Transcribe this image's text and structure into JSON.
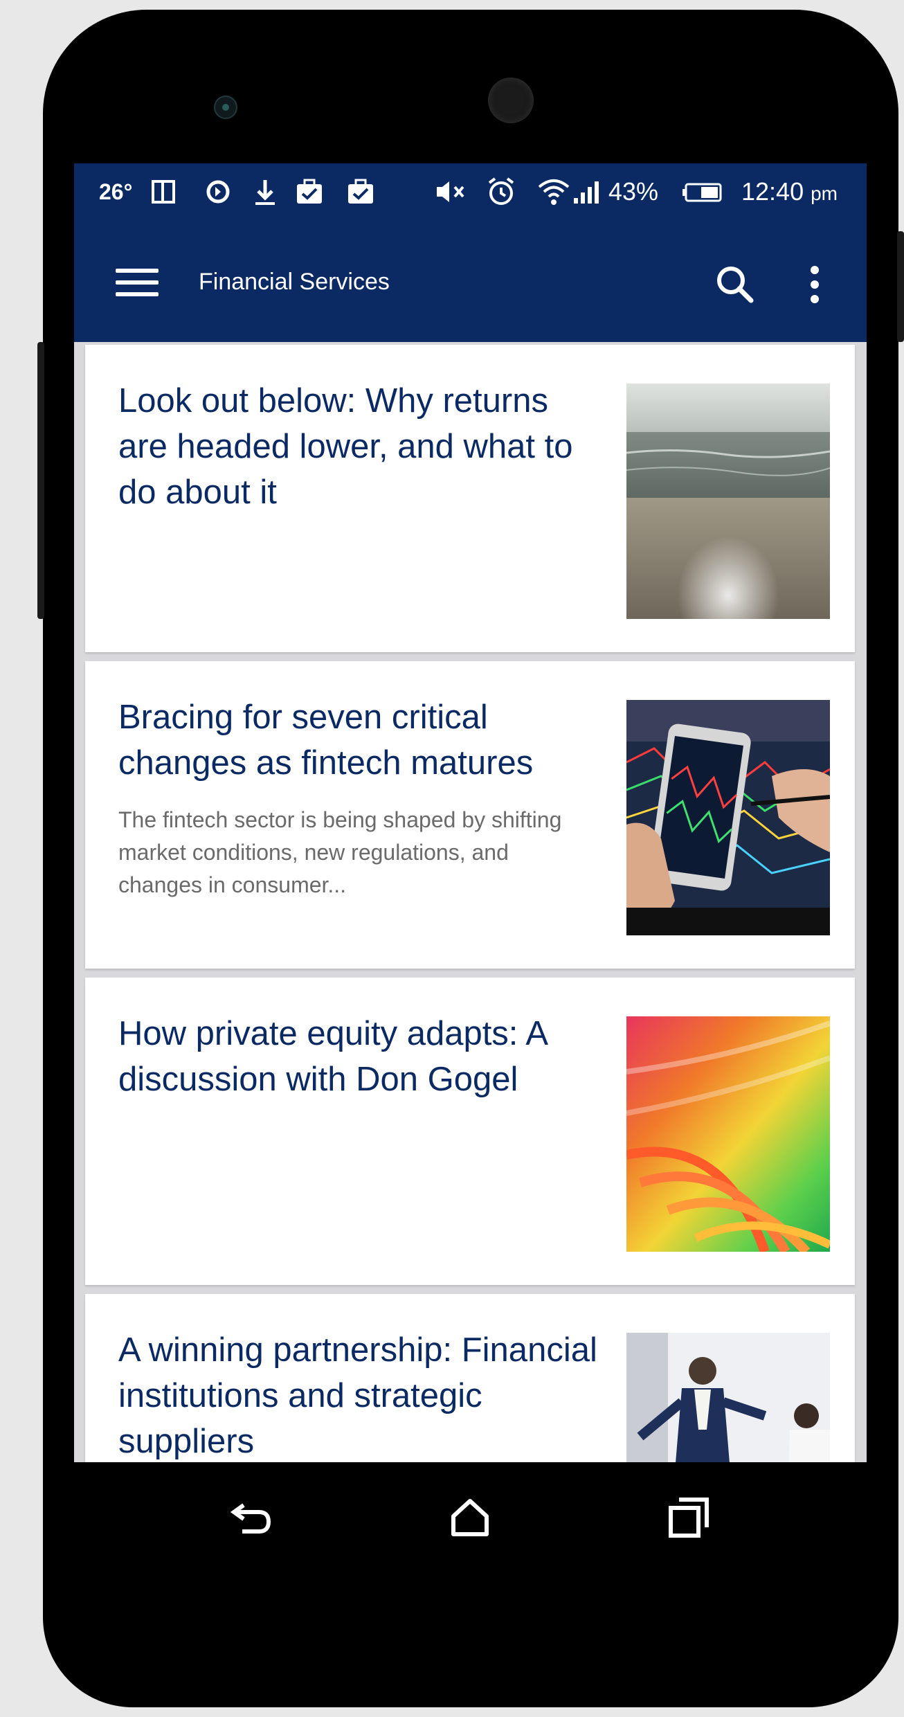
{
  "status_bar": {
    "temperature": "26°",
    "battery_percent": "43%",
    "time": "12:40",
    "time_suffix": "pm",
    "icons": [
      "sim-icon",
      "sync-icon",
      "download-icon",
      "briefcase-check-icon",
      "briefcase-check-icon",
      "mute-icon",
      "alarm-icon",
      "wifi-icon",
      "signal-icon",
      "battery-icon"
    ]
  },
  "app_bar": {
    "title": "Financial Services",
    "icons": [
      "menu-icon",
      "search-icon",
      "more-vert-icon"
    ]
  },
  "articles": [
    {
      "title": "Look out below: Why returns are headed lower, and what to do about it",
      "summary": "",
      "thumbnail": "beach-horizon-image"
    },
    {
      "title": "Bracing for seven critical changes as fintech matures",
      "summary": "The fintech sector is being shaped by shifting market conditions, new regulations, and changes in consumer...",
      "thumbnail": "smartphone-stock-chart-image"
    },
    {
      "title": "How private equity adapts: A discussion with Don Gogel",
      "summary": "",
      "thumbnail": "rainbow-spring-image"
    },
    {
      "title": "A winning partnership: Financial institutions and strategic suppliers",
      "summary": "",
      "thumbnail": "business-presentation-image"
    }
  ],
  "nav_bar": {
    "icons": [
      "back-icon",
      "home-icon",
      "recents-icon"
    ]
  },
  "colors": {
    "brand": "#0b2a63",
    "headline": "#0b2a63",
    "summary": "#6a6a6a",
    "background": "#d9d9dc"
  }
}
